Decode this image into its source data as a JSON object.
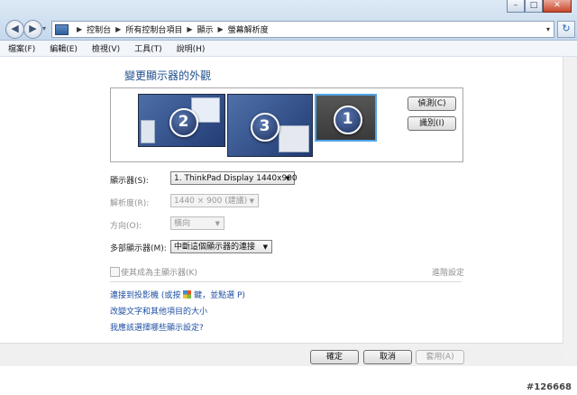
{
  "window": {
    "controls": {
      "minimize": "–",
      "maximize": "□",
      "close": "✕"
    }
  },
  "nav": {
    "back": "◀",
    "forward": "▶",
    "history_drop": "▾",
    "breadcrumbs": [
      "控制台",
      "所有控制台項目",
      "顯示",
      "螢幕解析度"
    ],
    "separator": "▶",
    "address_drop": "▾",
    "refresh": "↻"
  },
  "menu": [
    "檔案(F)",
    "編輯(E)",
    "檢視(V)",
    "工具(T)",
    "說明(H)"
  ],
  "heading": "變更顯示器的外觀",
  "monitors": [
    {
      "number": "2"
    },
    {
      "number": "3"
    },
    {
      "number": "1",
      "selected": true
    }
  ],
  "buttons": {
    "detect": "偵測(C)",
    "identify": "識別(I)"
  },
  "settings": [
    {
      "label": "顯示器(S):",
      "value": "1. ThinkPad Display 1440x900",
      "enabled": true
    },
    {
      "label": "解析度(R):",
      "value": "1440 × 900 (建議)",
      "enabled": false
    },
    {
      "label": "方向(O):",
      "value": "橫向",
      "enabled": false
    },
    {
      "label": "多部顯示器(M):",
      "value": "中斷這個顯示器的連接",
      "enabled": true
    }
  ],
  "combo_arrow": "▼",
  "checkbox": {
    "label": "使其成為主顯示器(K)",
    "checked": false,
    "enabled": false
  },
  "advanced": "進階設定",
  "links": {
    "projector_pre": "連接到投影機 (或按 ",
    "projector_post": " 鍵，並點選 P)",
    "text_size": "改變文字和其他項目的大小",
    "which_settings": "我應該選擇哪些顯示設定?"
  },
  "footer": {
    "ok": "確定",
    "cancel": "取消",
    "apply": "套用(A)"
  },
  "watermark": "#126668",
  "colors": {
    "heading": "#1f4e8c",
    "link": "#1e4fa3",
    "selected_border": "#4fa3e8"
  }
}
